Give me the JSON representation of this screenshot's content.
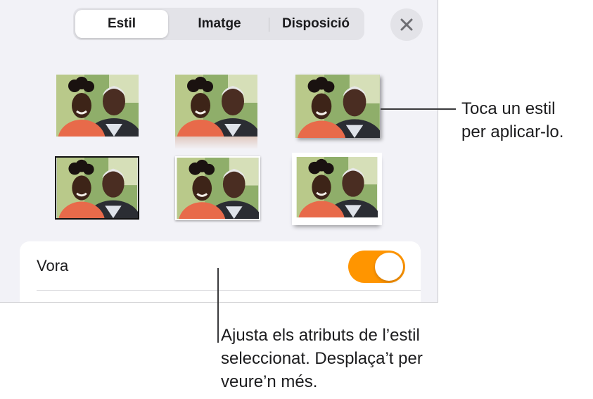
{
  "tabs": [
    {
      "label": "Estil",
      "active": true
    },
    {
      "label": "Imatge",
      "active": false
    },
    {
      "label": "Disposició",
      "active": false
    }
  ],
  "close_icon": "xmark-icon",
  "styles_grid": {
    "thumbnails": [
      {
        "style": "plain"
      },
      {
        "style": "reflection"
      },
      {
        "style": "shadow"
      },
      {
        "style": "thick-border"
      },
      {
        "style": "thin-frame"
      },
      {
        "style": "curled-shadow"
      }
    ]
  },
  "border_row": {
    "label": "Vora",
    "toggle_on": true
  },
  "callouts": {
    "style_hint": [
      "Toca un estil",
      "per aplicar-lo."
    ],
    "attributes_hint": [
      "Ajusta els atributs de l’estil",
      "seleccionat. Desplaça’t per",
      "veure’n més."
    ]
  },
  "colors": {
    "accent": "#ff9500",
    "panel_bg": "#f2f2f7"
  }
}
